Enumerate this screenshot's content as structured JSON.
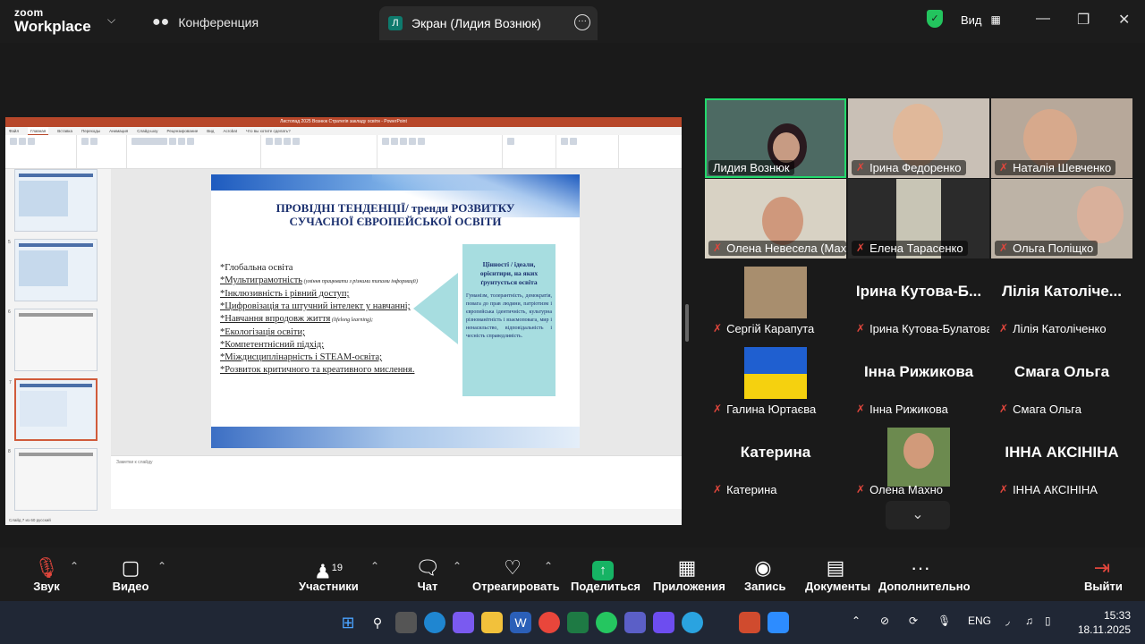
{
  "app": {
    "brand_line1": "zoom",
    "brand_line2": "Workplace"
  },
  "tabs": {
    "conference": "Конференция",
    "screen": "Экран (Лидия Вознюк)",
    "screen_badge": "Л"
  },
  "view_label": "Вид",
  "slide": {
    "title_line1": "ПРОВІДНІ ТЕНДЕНЦІЇ/ тренди РОЗВИТКУ",
    "title_line2": "СУЧАСНОЇ ЄВРОПЕЙСЬКОЇ ОСВІТИ",
    "bullets": [
      {
        "main": "*Глобальна освіта",
        "extra": ""
      },
      {
        "main": "*Мультиграмотність",
        "extra": " (уміння працювати з різними типами інформації)"
      },
      {
        "main": "*Інклюзивність і рівний доступ;",
        "extra": ""
      },
      {
        "main": "*Цифровізація та штучний інтелект у навчанні;",
        "extra": ""
      },
      {
        "main": "*Навчання впродовж життя",
        "extra": " (lifelong learning);"
      },
      {
        "main": "*Екологізація освіти;",
        "extra": ""
      },
      {
        "main": "*Компетентнісний підхід;",
        "extra": ""
      },
      {
        "main": "*Міждисциплінарність і STEAM-освіта;",
        "extra": ""
      },
      {
        "main": "*Розвиток критичного та креативного мислення.",
        "extra": ""
      }
    ],
    "values_heading": "Цінності / ідеали, орієнтири, на яких ґрунтується освіта",
    "values_body": "Гуманізм, толерантність, демократія, повага до прав людини, патріотизм і європейська ідентичність, культурна різноманітність і взаємоповага, мир і ненасильство, відповідальність і чесність справедливість.",
    "notes_placeholder": "Заметки к слайду",
    "window_title": "Листопад 2025 Вознюк Стратегія закладу освіти - PowerPoint",
    "ribbon_tabs": [
      "Файл",
      "Главная",
      "Вставка",
      "Переходы",
      "Анимация",
      "Слайд-шоу",
      "Рецензирование",
      "Вид",
      "Acrobat",
      "Что вы хотите сделать?"
    ],
    "status": "Слайд 7 из 60    русский"
  },
  "participants": [
    {
      "name": "Лидия Вознюк",
      "muted": false,
      "active": true,
      "has_video": true
    },
    {
      "name": "Ірина Федоренко",
      "muted": true,
      "has_video": true
    },
    {
      "name": "Наталія Шевченко",
      "muted": true,
      "has_video": true
    },
    {
      "name": "Олена Невесела (Мах...",
      "muted": true,
      "has_video": true
    },
    {
      "name": "Елена Тарасенко",
      "muted": true,
      "has_video": true
    },
    {
      "name": "Ольга Поліщко",
      "muted": true,
      "has_video": true
    },
    {
      "name": "Сергій Карапута",
      "muted": true,
      "has_video": true
    },
    {
      "name": "Ірина Кутова-Булатова",
      "muted": true,
      "big": "Ірина  Кутова-Б..."
    },
    {
      "name": "Лілія Католіченко",
      "muted": true,
      "big": "Лілія Католіче..."
    },
    {
      "name": "Галина Юртаєва",
      "muted": true,
      "has_video": true
    },
    {
      "name": "Інна Рижикова",
      "muted": true,
      "big": "Інна Рижикова"
    },
    {
      "name": "Смага Ольга",
      "muted": true,
      "big": "Смага Ольга"
    },
    {
      "name": "Катерина",
      "muted": true,
      "big": "Катерина"
    },
    {
      "name": "Олена Махно",
      "muted": true,
      "has_video": true
    },
    {
      "name": "ІННА АКСІНІНА",
      "muted": true,
      "big": "ІННА АКСІНІНА"
    }
  ],
  "toolbar": {
    "audio": "Звук",
    "video": "Видео",
    "participants": "Участники",
    "participants_count": "19",
    "chat": "Чат",
    "react": "Отреагировать",
    "share": "Поделиться",
    "apps": "Приложения",
    "record": "Запись",
    "docs": "Документы",
    "more": "Дополнительно",
    "leave": "Выйти"
  },
  "taskbar": {
    "lang": "ENG",
    "time": "15:33",
    "date": "18.11.2025"
  },
  "colors": {
    "accent_green": "#23d96c",
    "share_green": "#16b364",
    "muted_red": "#e0463c"
  }
}
